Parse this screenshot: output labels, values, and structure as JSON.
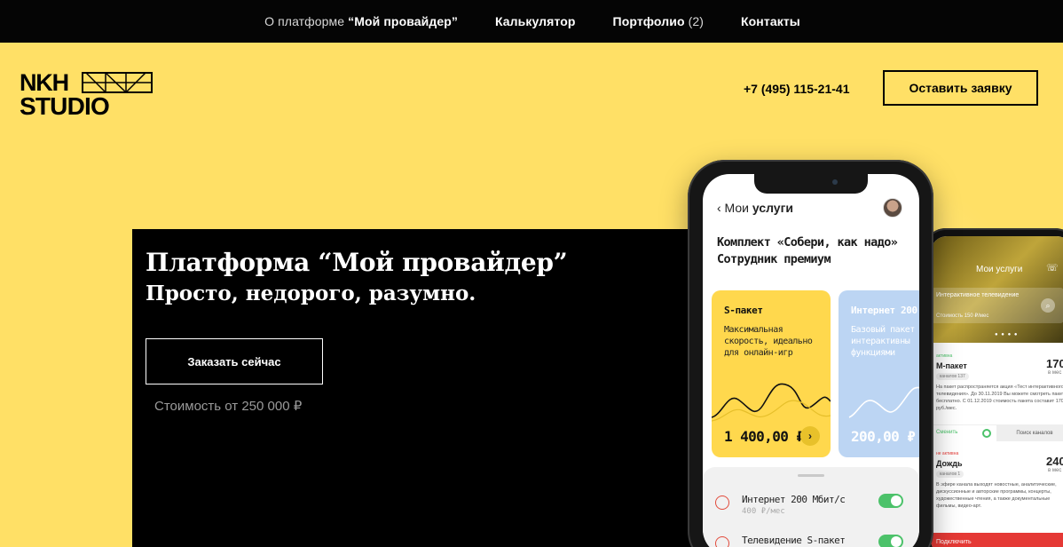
{
  "topnav": {
    "about_prefix": "О платформе ",
    "about_name": "“Мой провайдер”",
    "calculator": "Калькулятор",
    "portfolio": "Портфолио",
    "portfolio_count": "(2)",
    "contacts": "Контакты"
  },
  "header": {
    "logo_line1": "NKH",
    "logo_line2": "STUDIO",
    "phone": "+7 (495) 115-21-41",
    "cta": "Оставить заявку"
  },
  "hero": {
    "title": "Платформа “Мой провайдер”",
    "subtitle": "Просто, недорого, разумно.",
    "order_button": "Заказать сейчас",
    "price": "Стоимость от 250 000 ₽"
  },
  "phone_main": {
    "back_prefix": "‹ Мои ",
    "back_bold": "услуги",
    "heading": "Комплект «Собери, как надо» Сотрудник премиум",
    "card1": {
      "title": "S-пакет",
      "desc": "Максимальная скорость, идеально для онлайн-игр",
      "price": "1 400,00 ₽",
      "arrow": "›"
    },
    "card2": {
      "title": "Интернет 200",
      "desc": "Базовый пакет с интерактивны функциями",
      "price": "200,00 ₽"
    },
    "services": [
      {
        "name": "Интернет 200 Мбит/с",
        "price": "400 ₽/мес"
      },
      {
        "name": "Телевидение S-пакет",
        "price": ""
      }
    ]
  },
  "phone_second": {
    "title": "Мои услуги",
    "phone_icon": "☏",
    "banner_title": "Интерактивное телевидение",
    "banner_price": "Стоимость 150 ₽/мес",
    "search_icon": "⌕",
    "dots": "● ● ● ●",
    "card1": {
      "label": "активна",
      "name": "M-пакет",
      "chip": "каналов 137",
      "big": "170",
      "month": "в мес",
      "body": "На пакет распространяется акция «Тест интерактивного телевидения». До 30.11.2019 Вы можете смотреть пакет бесплатно. С 01.12.2019 стоимость пакета составит 170 руб./мес.",
      "action1": "Сменить",
      "action2": "Поиск каналов"
    },
    "card2": {
      "label": "не активна",
      "name": "Дождь",
      "chip": "каналов 1",
      "big": "240",
      "month": "в мес",
      "body": "В эфире канала выходят новостные, аналитические, дискуссионные и авторские программы, концерты, художественные чтения, а также документальные фильмы, видео-арт."
    },
    "connect": "Подключить"
  },
  "colors": {
    "page_bg": "#ffe066",
    "nav_bg": "#050505",
    "hero_bg": "#000000",
    "card_yellow": "#ffd84d",
    "card_blue": "#bcd5f3",
    "toggle_green": "#4cc26a",
    "connect_red": "#e53935"
  }
}
